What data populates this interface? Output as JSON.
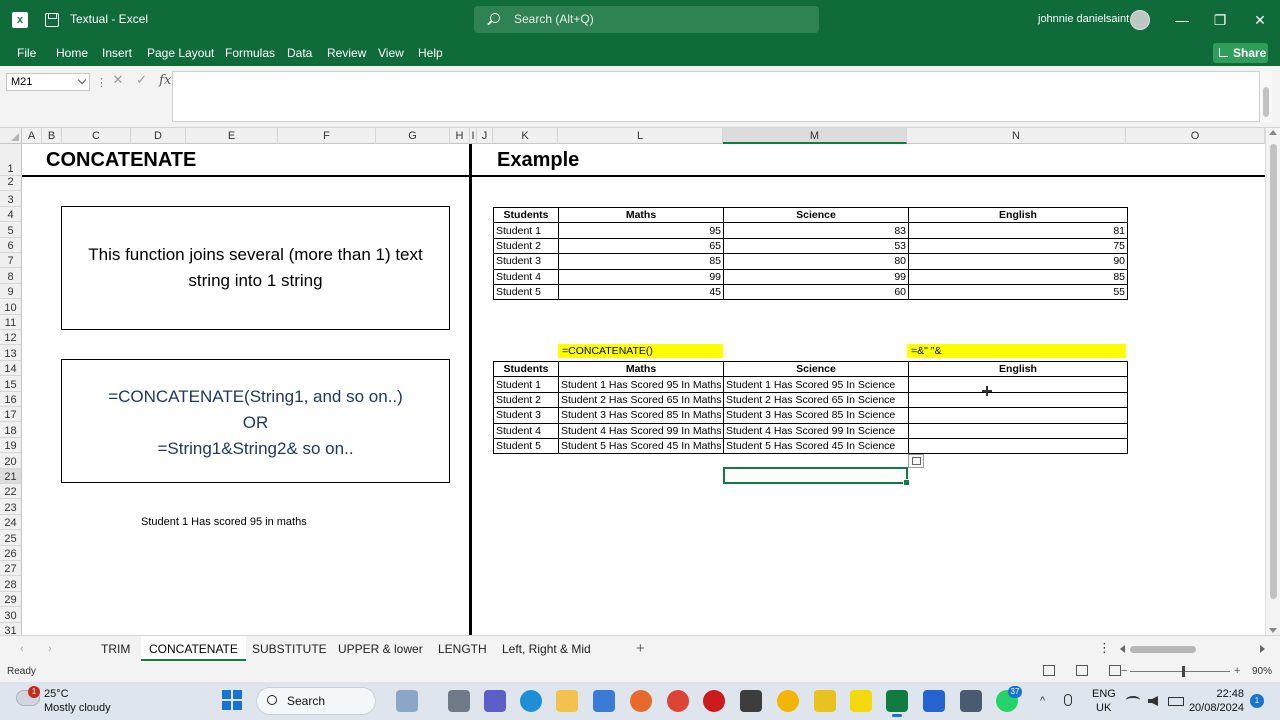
{
  "titlebar": {
    "doc_title": "Textual  -  Excel",
    "search_placeholder": "Search (Alt+Q)",
    "user_name": "johnnie danielsaint",
    "minimize": "—",
    "restore": "❐",
    "close": "✕"
  },
  "menu": {
    "items": [
      "File",
      "Home",
      "Insert",
      "Page Layout",
      "Formulas",
      "Data",
      "Review",
      "View",
      "Help"
    ],
    "share_label": "Share"
  },
  "formula_bar": {
    "name_box": "M21",
    "dots": "⋮",
    "cancel": "✕",
    "enter": "✓",
    "fx": "fx",
    "formula": ""
  },
  "columns": [
    "A",
    "B",
    "C",
    "D",
    "E",
    "F",
    "G",
    "H",
    "I",
    "J",
    "K",
    "L",
    "M",
    "N",
    "O"
  ],
  "rows": [
    "1",
    "2",
    "3",
    "4",
    "5",
    "6",
    "7",
    "8",
    "9",
    "10",
    "11",
    "12",
    "13",
    "14",
    "15",
    "16",
    "17",
    "18",
    "19",
    "20",
    "21",
    "22",
    "23",
    "24",
    "25",
    "26",
    "27",
    "28",
    "29",
    "30",
    "31"
  ],
  "left_panel": {
    "title": "CONCATENATE",
    "box1_line1": "This function joins several (more than 1) text",
    "box1_line2": "string into 1 string",
    "box2_line1": "=CONCATENATE(String1, and so on..)",
    "box2_line2": "OR",
    "box2_line3": "=String1&String2& so on..",
    "note": "Student 1 Has scored 95 in maths"
  },
  "right_panel": {
    "title": "Example",
    "table1": {
      "headers": [
        "Students",
        "Maths",
        "Science",
        "English"
      ],
      "rows": [
        [
          "Student 1",
          "95",
          "83",
          "81"
        ],
        [
          "Student 2",
          "65",
          "53",
          "75"
        ],
        [
          "Student 3",
          "85",
          "80",
          "90"
        ],
        [
          "Student 4",
          "99",
          "99",
          "85"
        ],
        [
          "Student 5",
          "45",
          "60",
          "55"
        ]
      ]
    },
    "label_concatenate": "=CONCATENATE()",
    "label_ampersand": "=&\"   \"&",
    "table2": {
      "headers": [
        "Students",
        "Maths",
        "Science",
        "English"
      ],
      "rows": [
        [
          "Student 1",
          "Student 1 Has Scored 95 In Maths",
          "Student 1 Has Scored 95 In Science",
          ""
        ],
        [
          "Student 2",
          "Student 2 Has Scored 65 In Maths",
          "Student 2 Has Scored 65 In Science",
          ""
        ],
        [
          "Student 3",
          "Student 3 Has Scored 85 In Maths",
          "Student 3 Has Scored 85 In Science",
          ""
        ],
        [
          "Student 4",
          "Student 4 Has Scored 99 In Maths",
          "Student 4 Has Scored 99 In Science",
          ""
        ],
        [
          "Student 5",
          "Student 5 Has Scored 45 In Maths",
          "Student 5 Has Scored 45 In Science",
          ""
        ]
      ]
    }
  },
  "sheet_tabs": {
    "tabs": [
      "TRIM",
      "CONCATENATE",
      "SUBSTITUTE",
      "UPPER & lower",
      "LENGTH",
      "Left, Right & Mid"
    ],
    "active": "CONCATENATE",
    "add": "+",
    "more": "⋮",
    "prev": "‹",
    "next": "›"
  },
  "status": {
    "ready": "Ready",
    "zoom_minus": "−",
    "zoom_plus": "+",
    "zoom": "90%"
  },
  "taskbar": {
    "weather_badge": "1",
    "temperature": "25°C",
    "condition": "Mostly cloudy",
    "search": "Search",
    "whatsapp_badge": "37",
    "tray_chevron": "^",
    "lang": "ENG",
    "region": "UK",
    "time": "22:48",
    "date": "20/08/2024",
    "notifications": "1"
  },
  "colors": {
    "excel_green": "#107c41",
    "titlebar_green": "#0f6b39",
    "highlight_yellow": "#ffff00"
  }
}
